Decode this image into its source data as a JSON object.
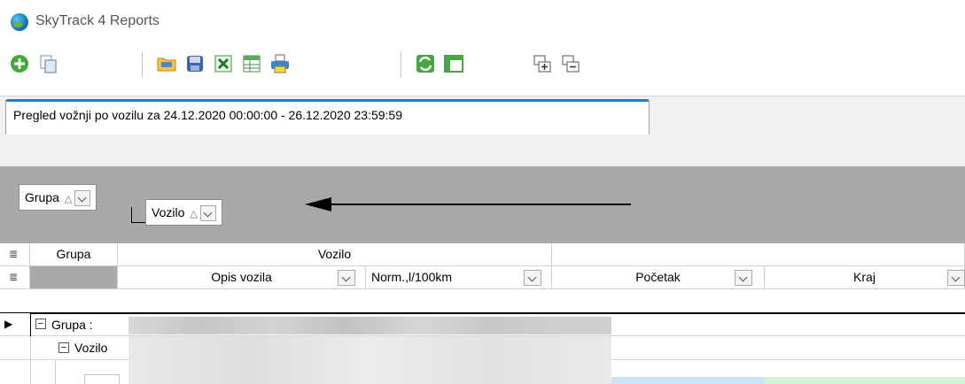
{
  "window": {
    "title": "SkyTrack 4 Reports"
  },
  "toolbar": {
    "buttons": [
      "add-icon",
      "copy-icon",
      "open-folder-icon",
      "save-disk-icon",
      "excel-export-icon",
      "table-export-icon",
      "print-icon",
      "refresh-icon",
      "layout-icon",
      "expand-all-icon",
      "collapse-all-icon"
    ]
  },
  "tab": {
    "label": "Pregled vožnji po vozilu za 24.12.2020 00:00:00 - 26.12.2020 23:59:59"
  },
  "group_panel": {
    "chips": [
      {
        "label": "Grupa",
        "sort": "△"
      },
      {
        "label": "Vozilo",
        "sort": "△"
      }
    ]
  },
  "grid": {
    "band_headers": [
      "Grupa",
      "Vozilo"
    ],
    "columns": [
      "Opis vozila",
      "Norm.,l/100km",
      "Početak",
      "Kraj"
    ],
    "rows": [
      {
        "label": "Grupa :"
      },
      {
        "label": "Vozilo"
      }
    ]
  },
  "colors": {
    "accent": "#1b7fce",
    "group_panel_bg": "#a9a9a9"
  }
}
